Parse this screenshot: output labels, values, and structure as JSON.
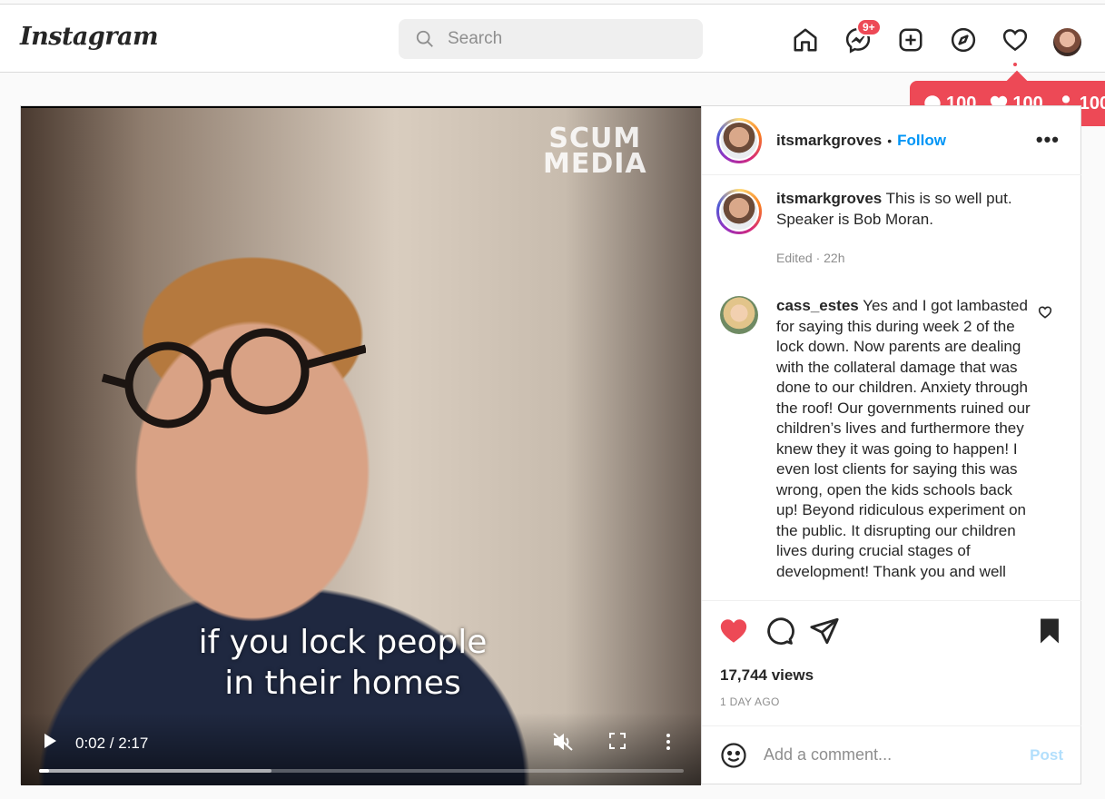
{
  "header": {
    "logo": "Instagram",
    "search_placeholder": "Search",
    "messenger_badge": "9+"
  },
  "activity_popup": {
    "comments": "100",
    "likes": "100",
    "followers": "100"
  },
  "video": {
    "watermark_line1": "SCUM",
    "watermark_line2": "MEDIA",
    "caption_line1": "if you lock people",
    "caption_line2": "in their homes",
    "time": "0:02 / 2:17",
    "progress_fraction": 0.015,
    "buffered_fraction": 0.36
  },
  "post": {
    "author": "itsmarkgroves",
    "separator": "•",
    "follow_label": "Follow",
    "more_label": "•••",
    "views": "17,744 views",
    "ago": "1 DAY AGO",
    "add_comment_placeholder": "Add a comment...",
    "post_label": "Post"
  },
  "comments": [
    {
      "user": "itsmarkgroves",
      "text": "This is so well put. Speaker is Bob Moran.",
      "meta": "Edited · 22h"
    },
    {
      "user": "cass_estes",
      "text": "Yes and I got lambasted for saying this during week 2 of the lock down. Now parents are dealing with the collateral damage that was done to our children. Anxiety through the roof! Our governments ruined our children’s lives and furthermore they knew they it was going to happen! I even lost clients for saying this was wrong, open the kids schools back up! Beyond ridiculous experiment on the public. It disrupting our children lives during crucial stages of development! Thank you and well"
    }
  ],
  "colors": {
    "accent_red": "#ed4956",
    "link_blue": "#0095f6",
    "post_disabled": "#b2dffc"
  }
}
